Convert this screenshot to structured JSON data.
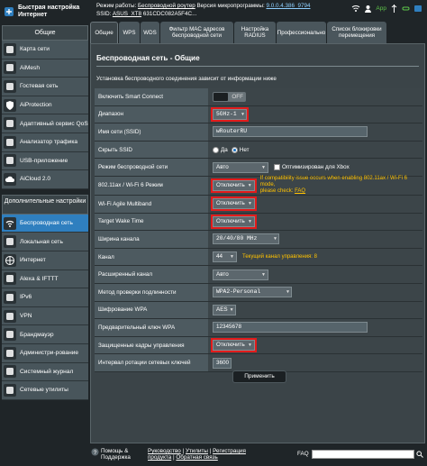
{
  "header": {
    "quick_setup_line1": "Быстрая настройка",
    "quick_setup_line2": "Интернет",
    "mode_label": "Режим работы:",
    "mode_value": "Беспроводной роутер",
    "fw_label": "Версия микропрограммы:",
    "fw_value": "9.0.0.4.386_9794",
    "ssid_label": "SSID:",
    "ssid_value": "ASUS_XT8",
    "ssid_value2": "631CDC082A5F4C...",
    "app_label": "App",
    "icons": [
      "wifi-icon",
      "user-icon",
      "usb-icon",
      "link-icon",
      "app-icon"
    ]
  },
  "sidebar": {
    "general_title": "Общие",
    "general_items": [
      {
        "label": "Карта сети",
        "icon": "network-map-icon"
      },
      {
        "label": "AiMesh",
        "icon": "aimesh-icon"
      },
      {
        "label": "Гостевая сеть",
        "icon": "guest-network-icon"
      },
      {
        "label": "AiProtection",
        "icon": "shield-icon"
      },
      {
        "label": "Адаптивный сервис QoS",
        "icon": "qos-icon"
      },
      {
        "label": "Анализатор трафика",
        "icon": "traffic-analyzer-icon"
      },
      {
        "label": "USB-приложение",
        "icon": "usb-app-icon"
      },
      {
        "label": "AiCloud 2.0",
        "icon": "cloud-icon"
      }
    ],
    "advanced_title": "Дополнительные настройки",
    "advanced_items": [
      {
        "label": "Беспроводная сеть",
        "icon": "wireless-icon",
        "active": true
      },
      {
        "label": "Локальная сеть",
        "icon": "lan-icon"
      },
      {
        "label": "Интернет",
        "icon": "globe-icon"
      },
      {
        "label": "Alexa & IFTTT",
        "icon": "alexa-icon"
      },
      {
        "label": "IPv6",
        "icon": "ipv6-icon"
      },
      {
        "label": "VPN",
        "icon": "vpn-icon"
      },
      {
        "label": "Брандмауэр",
        "icon": "firewall-icon"
      },
      {
        "label": "Администри-рование",
        "icon": "admin-icon"
      },
      {
        "label": "Системный журнал",
        "icon": "syslog-icon"
      },
      {
        "label": "Сетевые утилиты",
        "icon": "tools-icon"
      }
    ]
  },
  "tabs": [
    {
      "label": "Общие",
      "active": true
    },
    {
      "label": "WPS"
    },
    {
      "label": "WDS"
    },
    {
      "label": "Фильтр MAC адресов беспроводной сети"
    },
    {
      "label": "Настройка RADIUS"
    },
    {
      "label": "Профессионально"
    },
    {
      "label": "Список блокировки перемещения"
    }
  ],
  "main": {
    "title": "Беспроводная сеть - Общие",
    "description": "Установка беспроводного соединения зависит от информации ниже",
    "rows": {
      "smart_connect": {
        "label": "Включить Smart Connect",
        "value": "OFF"
      },
      "band": {
        "label": "Диапазон",
        "value": "5GHz-1"
      },
      "ssid": {
        "label": "Имя сети (SSID)",
        "value": "wRouterRU"
      },
      "hide_ssid": {
        "label": "Скрыть SSID",
        "opt_yes": "Да",
        "opt_no": "Нет"
      },
      "wireless_mode": {
        "label": "Режим беспроводной сети",
        "value": "Авто",
        "check_label": "Оптимизирован для Xbox"
      },
      "ax_mode": {
        "label": "802.11ax / Wi-Fi 6 Режим",
        "value": "Отключить",
        "note1": "If compatibility issue occurs when enabling 802.11ax / Wi-Fi 6 mode,",
        "note2": "please check:",
        "note_link": "FAQ"
      },
      "agile_multiband": {
        "label": "Wi-Fi Agile Multiband",
        "value": "Отключить"
      },
      "twt": {
        "label": "Target Wake Time",
        "value": "Отключить"
      },
      "channel_width": {
        "label": "Ширина канала",
        "value": "20/40/80 MHz"
      },
      "channel": {
        "label": "Канал",
        "value": "44",
        "note": "Текущий канал управления: 8"
      },
      "ext_channel": {
        "label": "Расширенный канал",
        "value": "Авто"
      },
      "auth_method": {
        "label": "Метод проверки подлинности",
        "value": "WPA2-Personal"
      },
      "wpa_enc": {
        "label": "Шифрование WPA",
        "value": "AES"
      },
      "wpa_key": {
        "label": "Предварительный ключ WPA",
        "value": "12345678"
      },
      "pmf": {
        "label": "Защищенные кадры управления",
        "value": "Отключить"
      },
      "key_rotation": {
        "label": "Интервал ротации сетевых ключей",
        "value": "3600"
      }
    },
    "apply_label": "Применить"
  },
  "footer": {
    "help_line1": "Помощь &",
    "help_line2": "Поддержка",
    "links_line1_a": "Руководство",
    "links_line1_b": "Утилиты",
    "links_line1_c": "Регистрация",
    "links_line2_a": "продукта",
    "links_line2_b": "Обратная связь",
    "faq_label": "FAQ"
  },
  "colors": {
    "highlight": "#e21b1b",
    "active_nav": "#2f7fbf",
    "note": "#ffc200"
  }
}
